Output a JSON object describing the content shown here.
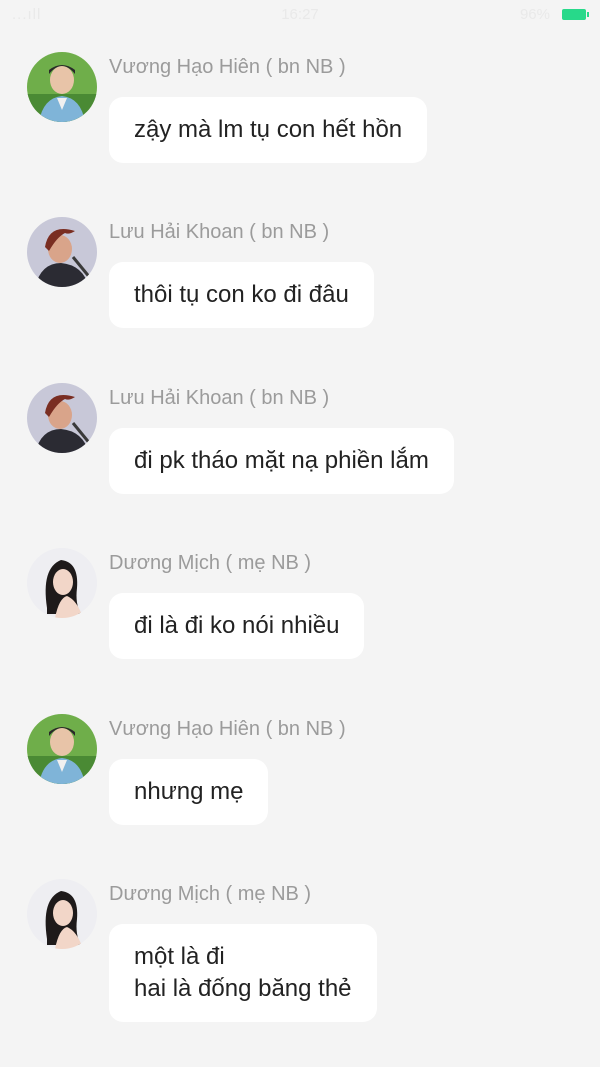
{
  "status_bar": {
    "signal": "...ıll",
    "time": "16:27",
    "battery": "96%"
  },
  "messages": [
    {
      "sender": "Vương Hạo Hiên ( bn NB )",
      "text": "zậy mà lm tụ con hết hồn",
      "avatar": "avatar-vuong-hao-hien"
    },
    {
      "sender": "Lưu Hải Khoan ( bn NB )",
      "text": "thôi tụ con ko đi đâu",
      "avatar": "avatar-luu-hai-khoan"
    },
    {
      "sender": "Lưu Hải Khoan ( bn NB )",
      "text": "đi pk tháo mặt nạ phiền lắm",
      "avatar": "avatar-luu-hai-khoan"
    },
    {
      "sender": "Dương Mịch ( mẹ NB )",
      "text": "đi là đi ko nói nhiều",
      "avatar": "avatar-duong-mich"
    },
    {
      "sender": "Vương Hạo Hiên ( bn NB )",
      "text": "nhưng mẹ",
      "avatar": "avatar-vuong-hao-hien"
    },
    {
      "sender": "Dương Mịch ( mẹ NB )",
      "text_lines": [
        "một là đi",
        "hai là đống băng thẻ"
      ],
      "avatar": "avatar-duong-mich"
    }
  ],
  "colors": {
    "background": "#f4f4f4",
    "bubble": "#ffffff",
    "sender": "#9b9b9b",
    "battery": "#27d98a"
  }
}
